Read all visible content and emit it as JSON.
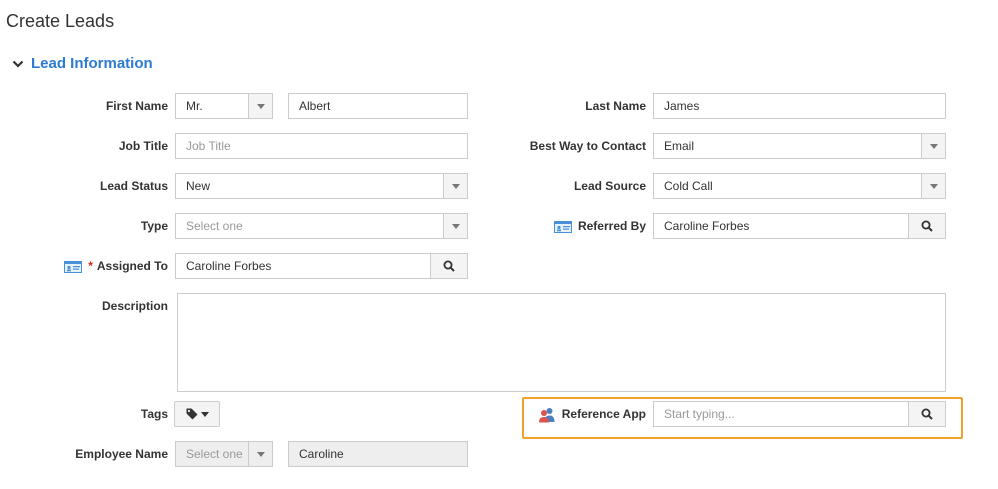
{
  "page": {
    "title": "Create Leads"
  },
  "section": {
    "title": "Lead Information"
  },
  "fields": {
    "first_name": {
      "label": "First Name",
      "salutation": "Mr.",
      "value": "Albert"
    },
    "last_name": {
      "label": "Last Name",
      "value": "James"
    },
    "job_title": {
      "label": "Job Title",
      "placeholder": "Job Title"
    },
    "best_way": {
      "label": "Best Way to Contact",
      "value": "Email"
    },
    "lead_status": {
      "label": "Lead Status",
      "value": "New"
    },
    "lead_source": {
      "label": "Lead Source",
      "value": "Cold Call"
    },
    "type": {
      "label": "Type",
      "placeholder": "Select one"
    },
    "referred_by": {
      "label": "Referred By",
      "value": "Caroline Forbes"
    },
    "assigned_to": {
      "label": "Assigned To",
      "required_mark": "*",
      "value": "Caroline Forbes"
    },
    "description": {
      "label": "Description"
    },
    "tags": {
      "label": "Tags"
    },
    "reference_app": {
      "label": "Reference App",
      "placeholder": "Start typing..."
    },
    "employee_name": {
      "label": "Employee Name",
      "placeholder": "Select one",
      "value": "Caroline"
    }
  },
  "icons": {
    "section_toggle": "chevron-down-icon",
    "select": "caret-down-icon",
    "lookup": "search-icon",
    "contact_card": "contact-card-icon",
    "users": "users-icon",
    "tag": "tag-icon"
  },
  "colors": {
    "accent": "#2b7bd0",
    "highlight": "#f2a12b",
    "required": "#d9261c"
  }
}
